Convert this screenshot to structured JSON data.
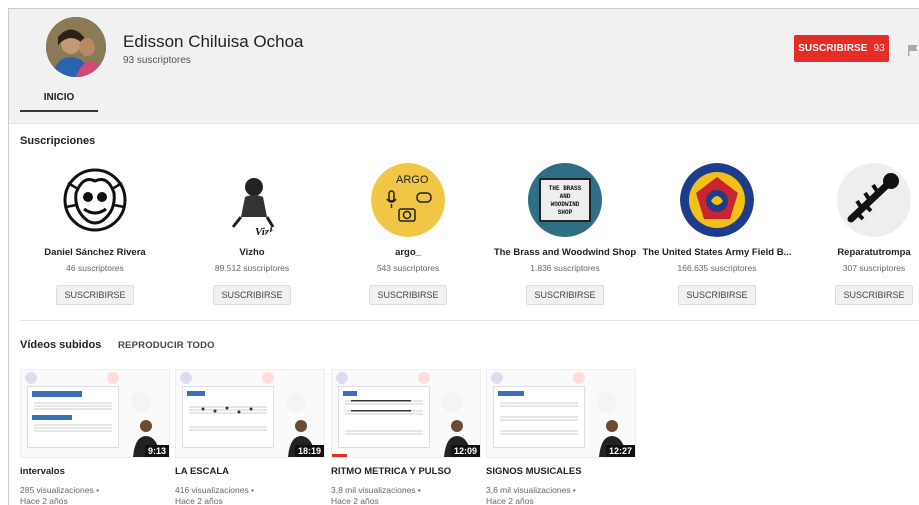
{
  "channel": {
    "name": "Edisson Chiluisa Ochoa",
    "subscribers": "93 suscriptores",
    "subscribe_label": "SUSCRIBIRSE",
    "subscribe_count": "93",
    "tab_home": "INICIO"
  },
  "subscriptions": {
    "title": "Suscripciones",
    "items": [
      {
        "name": "Daniel Sánchez Rivera",
        "subs": "46 suscriptores",
        "button": "SUSCRIBIRSE"
      },
      {
        "name": "Vizho",
        "subs": "89.512 suscriptores",
        "button": "SUSCRIBIRSE"
      },
      {
        "name": "argo_",
        "subs": "543 suscriptores",
        "button": "SUSCRIBIRSE"
      },
      {
        "name": "The Brass and Woodwind Shop",
        "subs": "1.836 suscriptores",
        "button": "SUSCRIBIRSE"
      },
      {
        "name": "The United States Army Field B...",
        "subs": "166.635 suscriptores",
        "button": "SUSCRIBIRSE"
      },
      {
        "name": "Reparatutrompa",
        "subs": "307 suscriptores",
        "button": "SUSCRIBIRSE"
      }
    ]
  },
  "uploads": {
    "title": "Vídeos subidos",
    "play_all": "REPRODUCIR TODO",
    "items": [
      {
        "title": "intervalos",
        "views": "285 visualizaciones •",
        "age": "Hace 2 años",
        "duration": "9:13"
      },
      {
        "title": "LA ESCALA",
        "views": "416 visualizaciones •",
        "age": "Hace 2 años",
        "duration": "18:19"
      },
      {
        "title": "RITMO METRICA Y PULSO",
        "views": "3,8 mil visualizaciones •",
        "age": "Hace 2 años",
        "duration": "12:09",
        "watched_progress": 0.1
      },
      {
        "title": "SIGNOS MUSICALES",
        "views": "3,6 mil visualizaciones •",
        "age": "Hace 2 años",
        "duration": "12:27"
      }
    ]
  },
  "sheet_titles": [
    "argo",
    "THE BRASS AND WOODWIND SHOP",
    "Vizho"
  ],
  "colors": {
    "accent": "#e52d27"
  }
}
